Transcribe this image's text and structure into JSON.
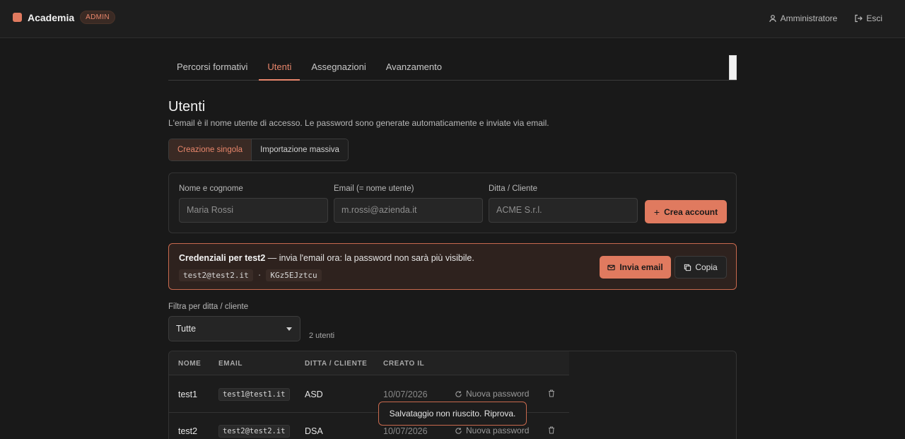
{
  "header": {
    "brand": "Academia",
    "badge": "ADMIN",
    "user_label": "Amministratore",
    "logout_label": "Esci"
  },
  "tabs": [
    {
      "label": "Percorsi formativi"
    },
    {
      "label": "Utenti"
    },
    {
      "label": "Assegnazioni"
    },
    {
      "label": "Avanzamento"
    }
  ],
  "page": {
    "title": "Utenti",
    "subtitle": "L'email è il nome utente di accesso. Le password sono generate automaticamente e inviate via email."
  },
  "mode": {
    "single": "Creazione singola",
    "bulk": "Importazione massiva"
  },
  "form": {
    "name_label": "Nome e cognome",
    "name_placeholder": "Maria Rossi",
    "email_label": "Email (= nome utente)",
    "email_placeholder": "m.rossi@azienda.it",
    "company_label": "Ditta / Cliente",
    "company_placeholder": "ACME S.r.l.",
    "create_label": "Crea account"
  },
  "credentials": {
    "prefix": "Credenziali per test2",
    "message": " — invia l'email ora: la password non sarà più visibile.",
    "email": "test2@test2.it",
    "separator": "·",
    "password": "KGz5EJztcu",
    "send_label": "Invia email",
    "copy_label": "Copia"
  },
  "filter": {
    "label": "Filtra per ditta / cliente",
    "selected": "Tutte",
    "count": "2 utenti"
  },
  "table": {
    "columns": [
      "NOME",
      "EMAIL",
      "DITTA / CLIENTE",
      "CREATO IL"
    ],
    "rows": [
      {
        "name": "test1",
        "email": "test1@test1.it",
        "company": "ASD",
        "created": "10/07/2026",
        "action": "Nuova password"
      },
      {
        "name": "test2",
        "email": "test2@test2.it",
        "company": "DSA",
        "created": "10/07/2026",
        "action": "Nuova password"
      }
    ]
  },
  "toast": {
    "message": "Salvataggio non riuscito. Riprova."
  },
  "colors": {
    "accent": "#e07a5f",
    "background": "#191919"
  }
}
